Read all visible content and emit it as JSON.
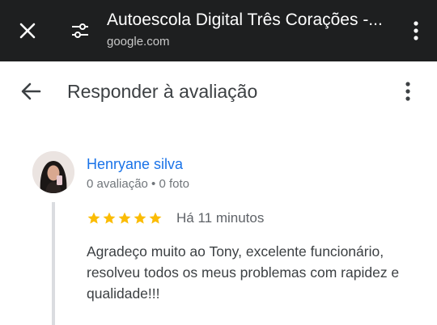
{
  "browser": {
    "title": "Autoescola Digital Três Corações -...",
    "url": "google.com"
  },
  "header": {
    "title": "Responder à avaliação"
  },
  "review": {
    "author": "Henryane silva",
    "meta": "0 avaliação • 0 foto",
    "rating": 5,
    "rating_max": 5,
    "time": "Há 11 minutos",
    "text": "Agradeço muito ao Tony, excelente funcionário, resolveu todos os meus problemas com rapidez e qualidade!!!"
  },
  "colors": {
    "topbar": "#1e1f20",
    "author_link": "#1a73e8",
    "star": "#fbbc04",
    "thread_line": "#dadce0"
  },
  "icons": {
    "close": "close-icon",
    "tune": "tune-icon",
    "back": "arrow-back-icon",
    "more": "more-vert-icon",
    "star": "star-icon"
  }
}
